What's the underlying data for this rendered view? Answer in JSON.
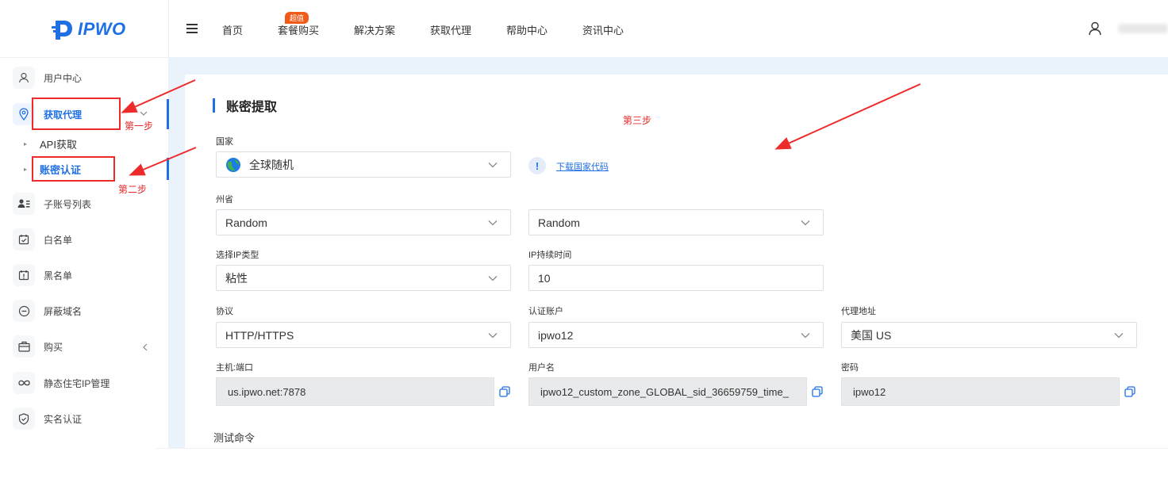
{
  "brand": {
    "logo_text": "IPWO"
  },
  "topnav": {
    "items": [
      "首页",
      "套餐购买",
      "解决方案",
      "获取代理",
      "帮助中心",
      "资讯中心"
    ],
    "hot_badge": "超值"
  },
  "sidebar": {
    "items": [
      {
        "label": "用户中心",
        "icon": "user-icon"
      },
      {
        "label": "获取代理",
        "icon": "location-pin-icon",
        "active": true
      },
      {
        "label": "子账号列表",
        "icon": "sub-accounts-icon"
      },
      {
        "label": "白名单",
        "icon": "whitelist-icon"
      },
      {
        "label": "黑名单",
        "icon": "blacklist-icon"
      },
      {
        "label": "屏蔽域名",
        "icon": "blocked-domain-icon"
      },
      {
        "label": "购买",
        "icon": "cart-icon"
      },
      {
        "label": "静态住宅IP管理",
        "icon": "infinity-icon"
      },
      {
        "label": "实名认证",
        "icon": "shield-check-icon"
      }
    ],
    "sub_items": [
      {
        "label": "API获取"
      },
      {
        "label": "账密认证",
        "active": true
      }
    ]
  },
  "annotations": {
    "step1": "第一步",
    "step2": "第二步",
    "step3": "第三步"
  },
  "form": {
    "title": "账密提取",
    "country": {
      "label": "国家",
      "value": "全球随机"
    },
    "download_link": "下载国家代码",
    "info_mark": "!",
    "state": {
      "label": "州省",
      "value": "Random"
    },
    "city": {
      "value": "Random"
    },
    "ip_type": {
      "label": "选择IP类型",
      "value": "粘性"
    },
    "ip_duration": {
      "label": "IP持续时间",
      "value": "10"
    },
    "protocol": {
      "label": "协议",
      "value": "HTTP/HTTPS"
    },
    "auth_account": {
      "label": "认证账户",
      "value": "ipwo12"
    },
    "proxy_address": {
      "label": "代理地址",
      "value": "美国 US"
    },
    "host_port": {
      "label": "主机:端口",
      "value": "us.ipwo.net:7878"
    },
    "username": {
      "label": "用户名",
      "value": "ipwo12_custom_zone_GLOBAL_sid_36659759_time_"
    },
    "password": {
      "label": "密码",
      "value": "ipwo12"
    },
    "test_command": {
      "label": "测试命令"
    }
  },
  "colors": {
    "accent": "#1f6fe5",
    "annotation_red": "#ee2b2b",
    "hot_badge": "#f25a18",
    "main_bg": "#eaf2fb"
  }
}
